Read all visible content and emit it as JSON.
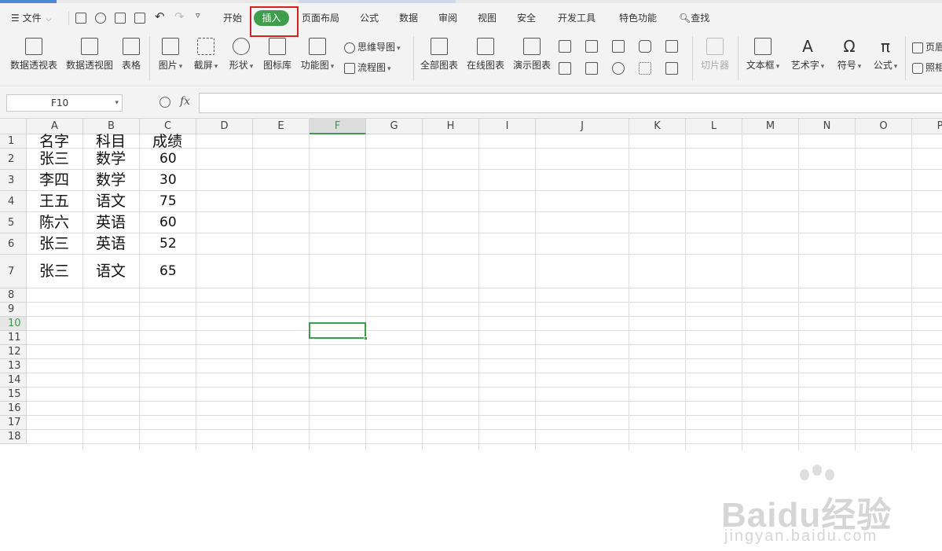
{
  "app": {
    "accent_color": "#3f9e4b",
    "highlight_color": "#d4201f"
  },
  "menubar": {
    "file_label": "文件",
    "tabs": [
      "开始",
      "插入",
      "页面布局",
      "公式",
      "数据",
      "审阅",
      "视图",
      "安全",
      "开发工具",
      "特色功能"
    ],
    "active_tab": "插入",
    "search_label": "查找"
  },
  "ribbon": {
    "large_tools": [
      "数据透视表",
      "数据透视图",
      "表格",
      "图片",
      "截屏",
      "形状",
      "图标库",
      "功能图",
      "全部图表",
      "在线图表",
      "演示图表",
      "切片器",
      "文本框",
      "艺术字",
      "符号",
      "公式"
    ],
    "small_tools": [
      "思维导图",
      "流程图",
      "页眉",
      "照相"
    ]
  },
  "formula": {
    "cell_ref": "F10",
    "fx_label": "fx",
    "value": ""
  },
  "sheet": {
    "columns": [
      "A",
      "B",
      "C",
      "D",
      "E",
      "F",
      "G",
      "H",
      "I",
      "J",
      "K",
      "L",
      "M",
      "N",
      "O",
      "P"
    ],
    "selected_column": "F",
    "rows": [
      "1",
      "2",
      "3",
      "4",
      "5",
      "6",
      "7",
      "8",
      "9",
      "10",
      "11",
      "12",
      "13",
      "14",
      "15",
      "16",
      "17",
      "18"
    ],
    "selected_row": "10",
    "data": [
      [
        "名字",
        "科目",
        "成绩"
      ],
      [
        "张三",
        "数学",
        "60"
      ],
      [
        "李四",
        "数学",
        "30"
      ],
      [
        "王五",
        "语文",
        "75"
      ],
      [
        "陈六",
        "英语",
        "60"
      ],
      [
        "张三",
        "英语",
        "52"
      ],
      [
        "张三",
        "语文",
        "65"
      ]
    ]
  },
  "watermark": {
    "logo": "Baidu经验",
    "sub": "jingyan.baidu.com"
  }
}
